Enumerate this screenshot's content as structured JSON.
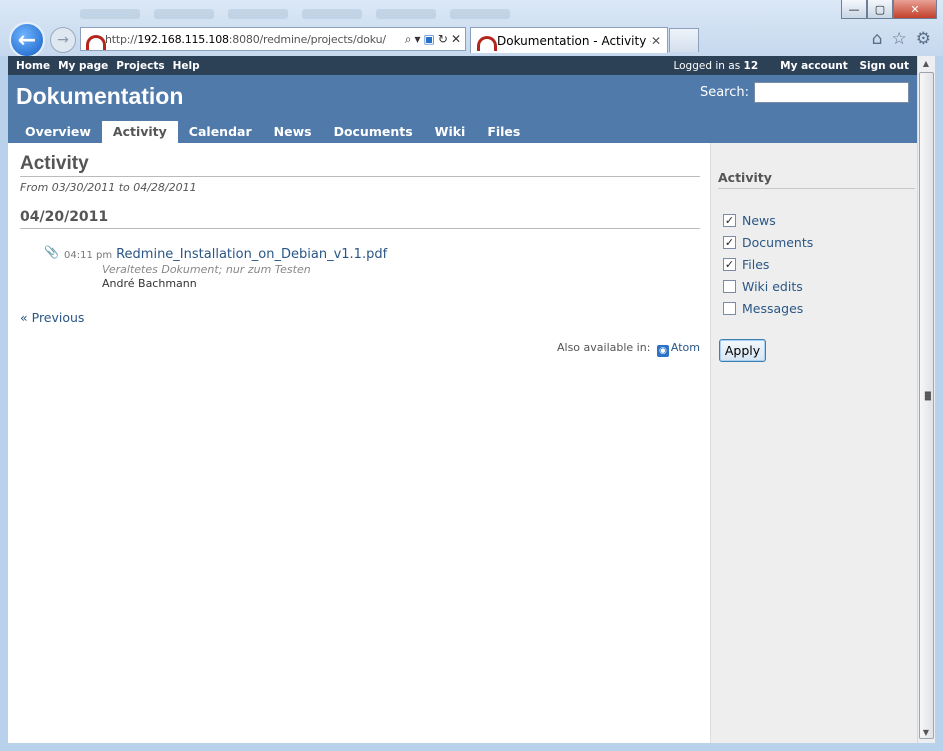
{
  "browser": {
    "url_prefix": "http://",
    "url_host": "192.168.115.108",
    "url_path": ":8080/redmine/projects/doku/",
    "tab_title": "Dokumentation - Activity - ...",
    "search_icon": "magnifier-icon",
    "refresh_icon": "refresh-icon",
    "close_icon": "close-icon"
  },
  "top_menu": {
    "items": [
      "Home",
      "My page",
      "Projects",
      "Help"
    ],
    "logged_in_prefix": "Logged in as",
    "user": "12",
    "my_account": "My account",
    "sign_out": "Sign out"
  },
  "header": {
    "title": "Dokumentation",
    "search_label": "Search:",
    "search_value": ""
  },
  "main_menu": {
    "tabs": [
      "Overview",
      "Activity",
      "Calendar",
      "News",
      "Documents",
      "Wiki",
      "Files"
    ],
    "selected": "Activity"
  },
  "content": {
    "title": "Activity",
    "subtitle": "From 03/30/2011 to 04/28/2011",
    "date_heading": "04/20/2011",
    "event": {
      "time": "04:11 pm",
      "title": "Redmine_Installation_on_Debian_v1.1.pdf",
      "description": "Veraltetes Dokument; nur zum Testen",
      "author": "André Bachmann"
    },
    "previous_link": "« Previous",
    "also_available": "Also available in:",
    "atom": "Atom"
  },
  "sidebar": {
    "title": "Activity",
    "filters": [
      {
        "label": "News",
        "checked": true
      },
      {
        "label": "Documents",
        "checked": true
      },
      {
        "label": "Files",
        "checked": true
      },
      {
        "label": "Wiki edits",
        "checked": false
      },
      {
        "label": "Messages",
        "checked": false
      }
    ],
    "apply_label": "Apply"
  }
}
